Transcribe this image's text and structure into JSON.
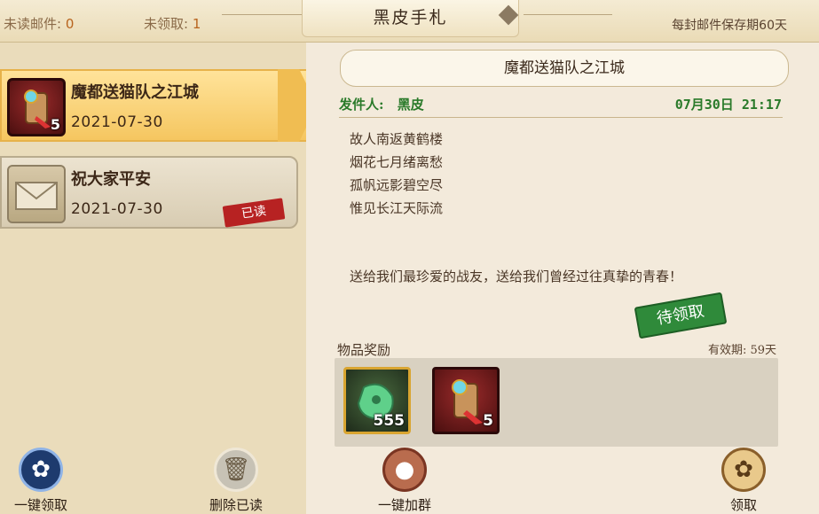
{
  "topbar": {
    "unread_label": "未读邮件:",
    "unread_count": "0",
    "unclaimed_label": "未领取:",
    "unclaimed_count": "1",
    "title": "黑皮手札",
    "retention": "每封邮件保存期60天"
  },
  "mail_list": [
    {
      "title": "魔都送猫队之江城",
      "date": "2021-07-30",
      "icon": "scroll-item-icon",
      "count": "5",
      "status": "selected"
    },
    {
      "title": "祝大家平安",
      "date": "2021-07-30",
      "icon": "envelope-icon",
      "status_label": "已读"
    }
  ],
  "detail": {
    "title": "魔都送猫队之江城",
    "sender_label": "发件人:",
    "sender_name": "黑皮",
    "datetime": "07月30日 21:17",
    "poem": [
      "故人南返黄鹤楼",
      "烟花七月绪离愁",
      "孤帆远影碧空尽",
      "惟见长江天际流"
    ],
    "note": "送给我们最珍爱的战友，送给我们曾经过往真挚的青春！",
    "pending_label": "待领取",
    "rewards_label": "物品奖励",
    "validity": "有效期: 59天",
    "rewards": [
      {
        "icon": "jade-item-icon",
        "count": "555"
      },
      {
        "icon": "scroll-item-icon",
        "count": "5"
      }
    ]
  },
  "actions": {
    "claim_all": "一键领取",
    "delete_read": "删除已读",
    "join_group": "一键加群",
    "claim": "领取"
  },
  "colors": {
    "accent_gold": "#f5c660",
    "sender_green": "#2a7a2a",
    "stamp_red": "#b72222",
    "pending_green": "#2f8a3a"
  }
}
